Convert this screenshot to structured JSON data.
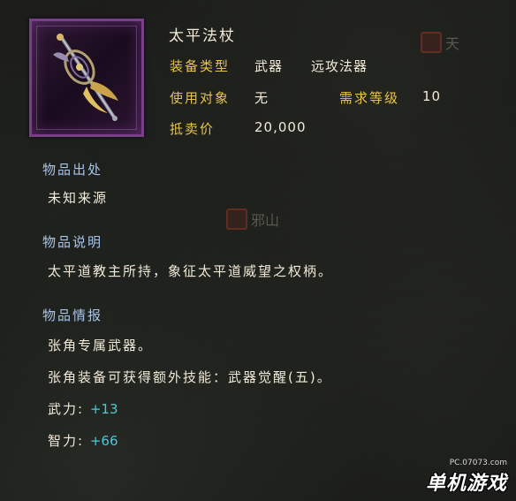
{
  "item": {
    "name": "太平法杖",
    "icon": "staff-icon",
    "type_label": "装备类型",
    "type_value_1": "武器",
    "type_value_2": "远攻法器",
    "target_label": "使用对象",
    "target_value": "无",
    "level_label": "需求等级",
    "level_value": "10",
    "price_label": "抵卖价",
    "price_value": "20,000"
  },
  "sections": {
    "origin_heading": "物品出处",
    "origin_text": "未知来源",
    "desc_heading": "物品说明",
    "desc_text": "太平道教主所持，象征太平道威望之权柄。",
    "info_heading": "物品情报",
    "info_line_1": "张角专属武器。",
    "info_line_2": "张角装备可获得额外技能：武器觉醒(五)。"
  },
  "stats": [
    {
      "label": "武力:",
      "value": "+13"
    },
    {
      "label": "智力:",
      "value": "+66"
    }
  ],
  "background_markers": [
    {
      "label": "天"
    },
    {
      "label": "邪山"
    }
  ],
  "watermark": {
    "url": "PC.07073.com",
    "brand": "单机游戏"
  },
  "colors": {
    "gold_label": "#e7c44a",
    "heading_blue": "#a9c4e8",
    "stat_cyan": "#4fc7d6",
    "frame_purple": "#7a3f8a"
  }
}
